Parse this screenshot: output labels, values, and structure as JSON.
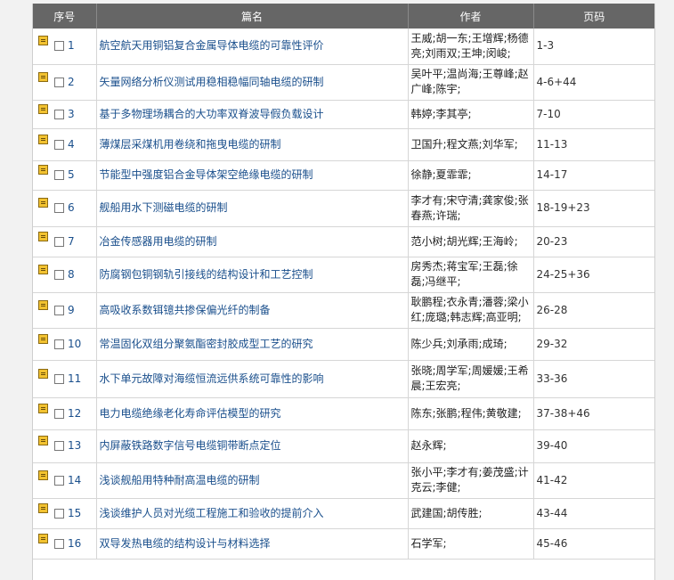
{
  "headers": {
    "seq": "序号",
    "title": "篇名",
    "authors": "作者",
    "pages": "页码"
  },
  "icons": {
    "row_icon": "document-icon",
    "checkbox": "checkbox-icon"
  },
  "rows": [
    {
      "num": "1",
      "title": "航空航天用铜铝复合金属导体电缆的可靠性评价",
      "authors": "王威;胡一东;王增辉;杨德亮;刘雨双;王坤;闵峻;",
      "pages": "1-3",
      "h": 40
    },
    {
      "num": "2",
      "title": "矢量网络分析仪测试用稳相稳幅同轴电缆的研制",
      "authors": "吴叶平;温尚海;王尊峰;赵广峰;陈宇;",
      "pages": "4-6+44",
      "h": 40
    },
    {
      "num": "3",
      "title": "基于多物理场耦合的大功率双脊波导假负载设计",
      "authors": "韩婷;李其亭;",
      "pages": "7-10",
      "h": 32
    },
    {
      "num": "4",
      "title": "薄煤层采煤机用卷绕和拖曳电缆的研制",
      "authors": "卫国升;程文燕;刘华军;",
      "pages": "11-13",
      "h": 36
    },
    {
      "num": "5",
      "title": "节能型中强度铝合金导体架空绝缘电缆的研制",
      "authors": "徐静;夏霏霏;",
      "pages": "14-17",
      "h": 33
    },
    {
      "num": "6",
      "title": "舰船用水下测磁电缆的研制",
      "authors": "李才有;宋守清;龚家俊;张春燕;许瑞;",
      "pages": "18-19+23",
      "h": 41
    },
    {
      "num": "7",
      "title": "冶金传感器用电缆的研制",
      "authors": "范小树;胡光辉;王海岭;",
      "pages": "20-23",
      "h": 34
    },
    {
      "num": "8",
      "title": "防腐钢包铜钢轨引接线的结构设计和工艺控制",
      "authors": "房秀杰;蒋宝军;王磊;徐磊;冯继平;",
      "pages": "24-25+36",
      "h": 40
    },
    {
      "num": "9",
      "title": "高吸收系数铒镱共掺保偏光纤的制备",
      "authors": "耿鹏程;衣永青;潘蓉;梁小红;庞璐;韩志辉;高亚明;",
      "pages": "26-28",
      "h": 40
    },
    {
      "num": "10",
      "title": "常温固化双组分聚氨酯密封胶成型工艺的研究",
      "authors": "陈少兵;刘承雨;成琦;",
      "pages": "29-32",
      "h": 36
    },
    {
      "num": "11",
      "title": "水下单元故障对海缆恒流远供系统可靠性的影响",
      "authors": "张晓;周学军;周媛媛;王希晨;王宏亮;",
      "pages": "33-36",
      "h": 42
    },
    {
      "num": "12",
      "title": "电力电缆绝缘老化寿命评估模型的研究",
      "authors": "陈东;张鹏;程伟;黄敬建;",
      "pages": "37-38+46",
      "h": 36
    },
    {
      "num": "13",
      "title": "内屏蔽铁路数字信号电缆铜带断点定位",
      "authors": "赵永辉;",
      "pages": "39-40",
      "h": 37
    },
    {
      "num": "14",
      "title": "浅谈舰船用特种耐高温电缆的研制",
      "authors": "张小平;李才有;姜茂盛;计克云;李健;",
      "pages": "41-42",
      "h": 40
    },
    {
      "num": "15",
      "title": "浅谈维护人员对光缆工程施工和验收的提前介入",
      "authors": "武建国;胡传胜;",
      "pages": "43-44",
      "h": 34
    },
    {
      "num": "16",
      "title": "双导发热电缆的结构设计与材料选择",
      "authors": "石学军;",
      "pages": "45-46",
      "h": 34
    }
  ]
}
